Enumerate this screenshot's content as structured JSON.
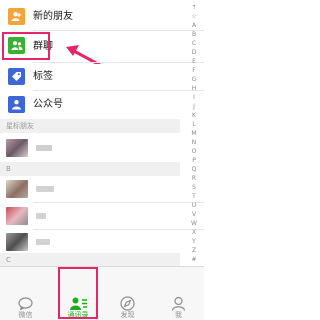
{
  "top_items": [
    {
      "label": "新的朋友",
      "icon": "new-friend-icon",
      "color": "#f5a33b"
    },
    {
      "label": "群聊",
      "icon": "group-chat-icon",
      "color": "#3cb034"
    },
    {
      "label": "标签",
      "icon": "tag-icon",
      "color": "#3d67d6"
    },
    {
      "label": "公众号",
      "icon": "official-account-icon",
      "color": "#3d67d6"
    }
  ],
  "sections": {
    "starred": "星标朋友",
    "b": "B",
    "c": "C"
  },
  "index_letters": [
    "↑",
    "☆",
    "A",
    "B",
    "C",
    "D",
    "E",
    "F",
    "G",
    "H",
    "I",
    "J",
    "K",
    "L",
    "M",
    "N",
    "O",
    "P",
    "Q",
    "R",
    "S",
    "T",
    "U",
    "V",
    "W",
    "X",
    "Y",
    "Z",
    "#"
  ],
  "tabbar": {
    "tabs": [
      {
        "label": "微信",
        "icon": "chat-bubble-icon"
      },
      {
        "label": "通讯录",
        "icon": "contacts-icon",
        "active": true
      },
      {
        "label": "发现",
        "icon": "compass-icon"
      },
      {
        "label": "我",
        "icon": "me-icon"
      }
    ]
  },
  "colors": {
    "accent": "#1aad19",
    "highlight_box": "#e8256b",
    "arrow": "#e8256b"
  }
}
